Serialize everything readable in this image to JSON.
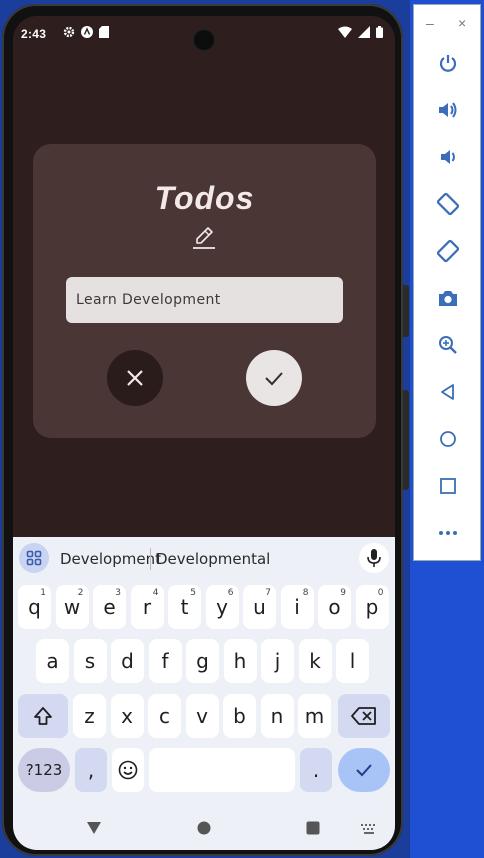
{
  "status_bar": {
    "time": "2:43"
  },
  "dialog": {
    "title": "Todos",
    "input_value": "Learn Development",
    "cancel_icon": "close-icon",
    "confirm_icon": "check-icon",
    "edit_icon": "pencil-icon"
  },
  "keyboard": {
    "suggestions": [
      "Development",
      "Developmental"
    ],
    "row1": [
      {
        "k": "q",
        "n": "1"
      },
      {
        "k": "w",
        "n": "2"
      },
      {
        "k": "e",
        "n": "3"
      },
      {
        "k": "r",
        "n": "4"
      },
      {
        "k": "t",
        "n": "5"
      },
      {
        "k": "y",
        "n": "6"
      },
      {
        "k": "u",
        "n": "7"
      },
      {
        "k": "i",
        "n": "8"
      },
      {
        "k": "o",
        "n": "9"
      },
      {
        "k": "p",
        "n": "0"
      }
    ],
    "row2": [
      "a",
      "s",
      "d",
      "f",
      "g",
      "h",
      "j",
      "k",
      "l"
    ],
    "row3": [
      "z",
      "x",
      "c",
      "v",
      "b",
      "n",
      "m"
    ],
    "symbols_label": "?123",
    "comma": ",",
    "period": "."
  },
  "emulator_panel": {
    "tools": [
      "power-icon",
      "volume-up-icon",
      "volume-down-icon",
      "rotate-left-icon",
      "rotate-right-icon",
      "camera-icon",
      "zoom-icon",
      "back-icon",
      "home-icon",
      "overview-icon",
      "more-icon"
    ]
  },
  "colors": {
    "background": "#2e1f1e",
    "dialog": "#4a3634",
    "accent": "#a8c3f5"
  }
}
